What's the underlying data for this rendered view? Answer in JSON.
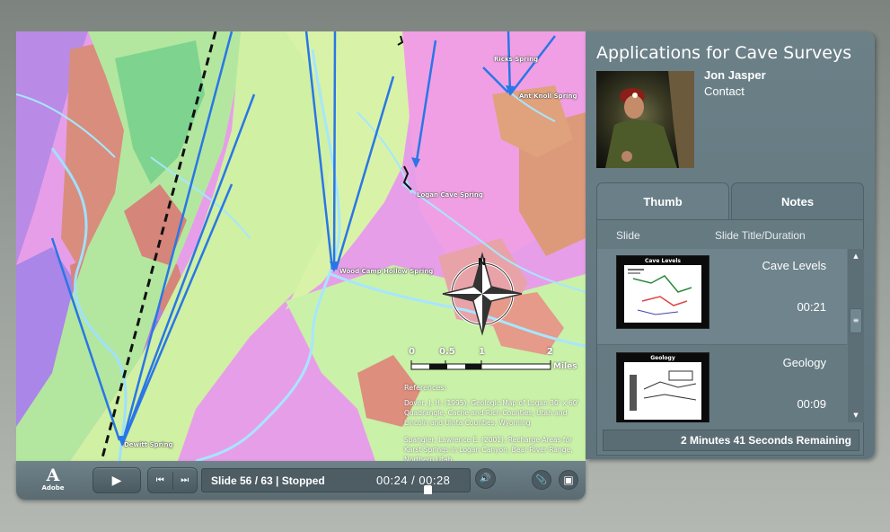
{
  "slide": {
    "map_labels": {
      "spring1": "Ricks Spring",
      "spring2": "Dewitt Spring",
      "spring3": "Logan Cave Spring",
      "spring4": "Wood Camp Hollow Spring",
      "spring5": "Ant Knoll Spring",
      "spring6": "Dewitt Spring"
    },
    "scale_bar": {
      "ticks": [
        "0",
        "0.5",
        "1",
        "2"
      ],
      "unit": "Miles"
    },
    "compass_letter": "N",
    "references": {
      "heading": "References:",
      "ref1": "Dover, J. H. (1995), Geologic Map of Logan 30' x 60' Quadrangle, Cache and Rich Counties, Utah and Lincoln and Uinta Counties, Wyoming",
      "ref2": "Spangler, Lawrence E. (2001), Recharge Areas for Karst Springs in Logan Canyon, Bear River Range, Northern Utah"
    }
  },
  "controls": {
    "logo_text": "Adobe",
    "play_icon": "▶",
    "prev_icon": "⏮",
    "next_icon": "⏭",
    "slide_status": "Slide 56 / 63 | Stopped",
    "time": "00:24 / 00:28",
    "volume_icon": "🔊",
    "attach_icon": "📎",
    "sidebar_icon": "▣"
  },
  "sidebar": {
    "title": "Applications for Cave Surveys",
    "presenter_name": "Jon Jasper",
    "contact_label": "Contact",
    "tabs": {
      "thumb": "Thumb",
      "notes": "Notes"
    },
    "columns": {
      "slide": "Slide",
      "title_duration": "Slide Title/Duration"
    },
    "items": [
      {
        "thumb_caption": "Cave Levels",
        "title": "Cave Levels",
        "duration": "00:21"
      },
      {
        "thumb_caption": "Geology",
        "title": "Geology",
        "duration": "00:09"
      }
    ],
    "scroll_up": "▲",
    "scroll_down": "▼",
    "scroll_grip": "≡",
    "remaining": "2 Minutes 41 Seconds Remaining"
  }
}
